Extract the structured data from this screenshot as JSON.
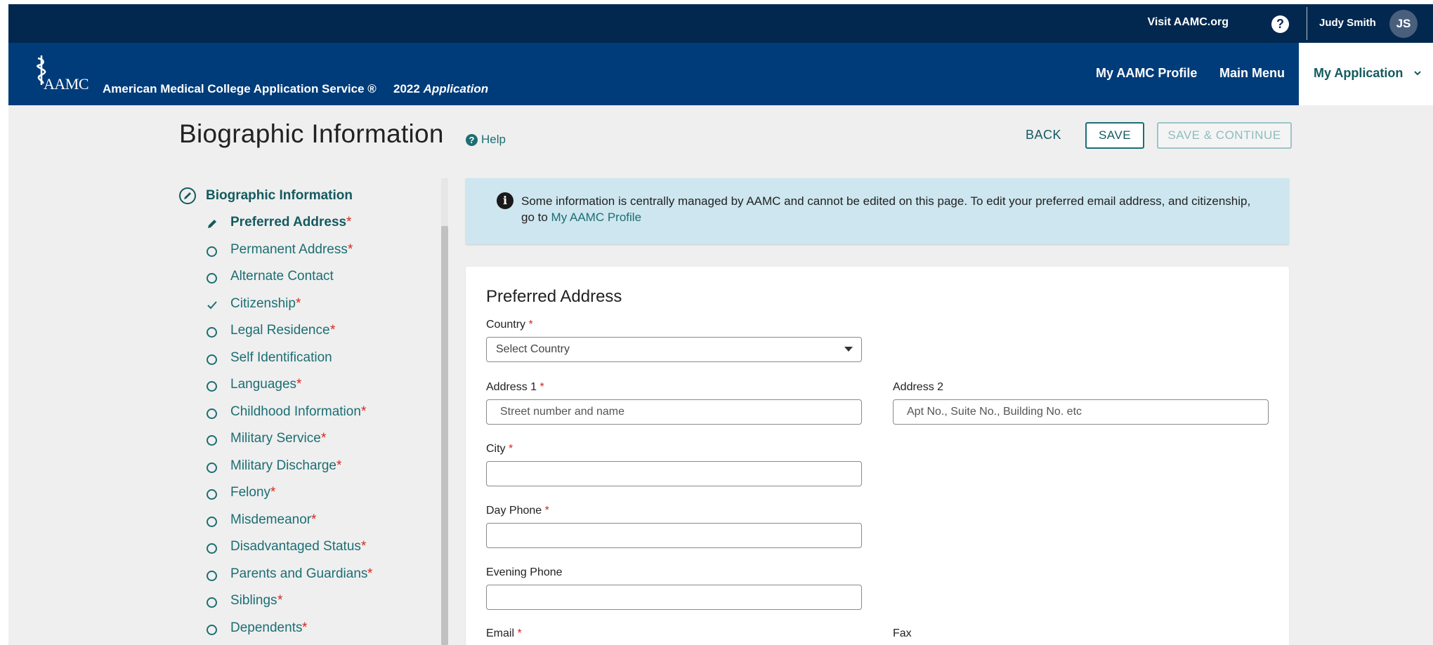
{
  "utility_bar": {
    "visit_link": "Visit AAMC.org",
    "help_glyph": "?",
    "user_name": "Judy Smith",
    "user_initials": "JS"
  },
  "header": {
    "logo_text": "AAMC",
    "service_name": "American Medical College Application Service ®",
    "app_year": "2022",
    "app_word": "Application",
    "nav": [
      "My AAMC Profile",
      "Main Menu"
    ],
    "active_nav": "My Application"
  },
  "page": {
    "title": "Biographic Information",
    "help_label": "Help",
    "buttons": {
      "back": "BACK",
      "save": "SAVE",
      "save_continue": "SAVE & CONTINUE"
    }
  },
  "sidebar": {
    "heading": "Biographic Information",
    "items": [
      {
        "label": "Preferred Address",
        "required": "*",
        "state": "editing"
      },
      {
        "label": "Permanent Address",
        "required": "*",
        "state": "incomplete"
      },
      {
        "label": "Alternate Contact",
        "required": "",
        "state": "incomplete"
      },
      {
        "label": "Citizenship",
        "required": "*",
        "state": "complete"
      },
      {
        "label": "Legal Residence",
        "required": "*",
        "state": "incomplete"
      },
      {
        "label": "Self Identification",
        "required": "",
        "state": "incomplete"
      },
      {
        "label": "Languages",
        "required": "*",
        "state": "incomplete"
      },
      {
        "label": "Childhood Information",
        "required": "*",
        "state": "incomplete"
      },
      {
        "label": "Military Service",
        "required": "*",
        "state": "incomplete"
      },
      {
        "label": "Military Discharge",
        "required": "*",
        "state": "incomplete"
      },
      {
        "label": "Felony",
        "required": "*",
        "state": "incomplete"
      },
      {
        "label": "Misdemeanor",
        "required": "*",
        "state": "incomplete"
      },
      {
        "label": "Disadvantaged Status",
        "required": "*",
        "state": "incomplete"
      },
      {
        "label": "Parents and Guardians",
        "required": "*",
        "state": "incomplete"
      },
      {
        "label": "Siblings",
        "required": "*",
        "state": "incomplete"
      },
      {
        "label": "Dependents",
        "required": "*",
        "state": "incomplete"
      }
    ]
  },
  "info_banner": {
    "icon_glyph": "i",
    "text": "Some information is centrally managed by AAMC and cannot be edited on this page. To edit your preferred email address, and citizenship, go to",
    "link": "My AAMC Profile"
  },
  "form": {
    "section_title": "Preferred Address",
    "required_mark": "*",
    "country": {
      "label": "Country",
      "value": "Select Country"
    },
    "address1": {
      "label": "Address 1",
      "placeholder": "Street number and name"
    },
    "address2": {
      "label": "Address 2",
      "placeholder": "Apt No., Suite No., Building No. etc"
    },
    "city": {
      "label": "City",
      "value": ""
    },
    "day_phone": {
      "label": "Day Phone",
      "value": ""
    },
    "evening_phone": {
      "label": "Evening Phone",
      "value": ""
    },
    "email": {
      "label": "Email"
    },
    "fax": {
      "label": "Fax"
    }
  },
  "colors": {
    "utility_bar": "#022850",
    "nav_bar": "#003c7a",
    "accent_teal": "#1c6e73",
    "required_red": "#d2281e",
    "banner_bg": "#cde6ef"
  }
}
